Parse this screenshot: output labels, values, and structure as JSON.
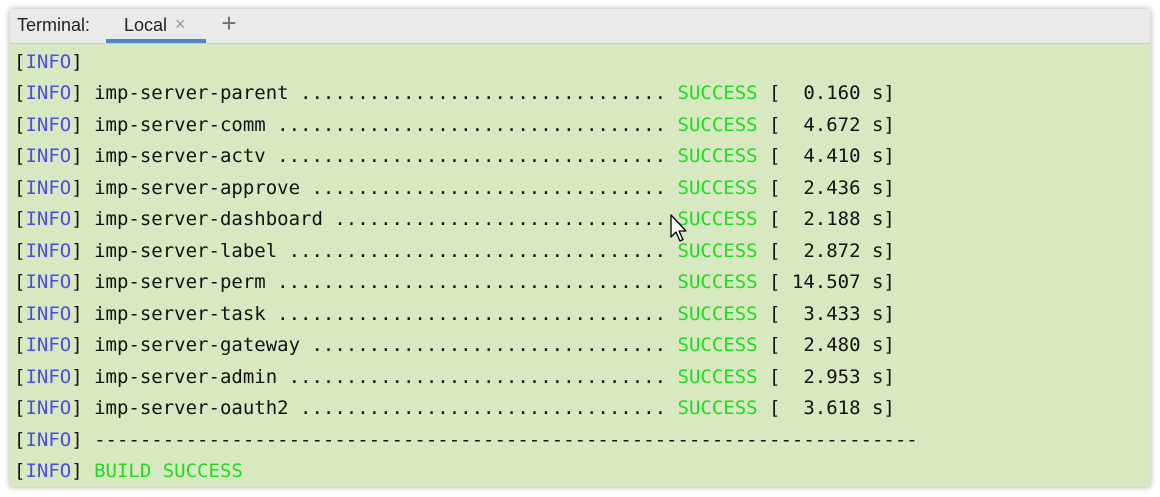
{
  "terminal": {
    "title": "Terminal:",
    "tab_label": "Local",
    "close_glyph": "×",
    "add_glyph": "+"
  },
  "lines": [
    {
      "level": "INFO",
      "text": "",
      "status": "",
      "time": ""
    },
    {
      "level": "INFO",
      "text": "imp-server-parent ................................",
      "status": "SUCCESS",
      "time": "[  0.160 s]"
    },
    {
      "level": "INFO",
      "text": "imp-server-comm ..................................",
      "status": "SUCCESS",
      "time": "[  4.672 s]"
    },
    {
      "level": "INFO",
      "text": "imp-server-actv ..................................",
      "status": "SUCCESS",
      "time": "[  4.410 s]"
    },
    {
      "level": "INFO",
      "text": "imp-server-approve ...............................",
      "status": "SUCCESS",
      "time": "[  2.436 s]"
    },
    {
      "level": "INFO",
      "text": "imp-server-dashboard .............................",
      "status": "SUCCESS",
      "time": "[  2.188 s]"
    },
    {
      "level": "INFO",
      "text": "imp-server-label .................................",
      "status": "SUCCESS",
      "time": "[  2.872 s]"
    },
    {
      "level": "INFO",
      "text": "imp-server-perm ..................................",
      "status": "SUCCESS",
      "time": "[ 14.507 s]"
    },
    {
      "level": "INFO",
      "text": "imp-server-task ..................................",
      "status": "SUCCESS",
      "time": "[  3.433 s]"
    },
    {
      "level": "INFO",
      "text": "imp-server-gateway ...............................",
      "status": "SUCCESS",
      "time": "[  2.480 s]"
    },
    {
      "level": "INFO",
      "text": "imp-server-admin .................................",
      "status": "SUCCESS",
      "time": "[  2.953 s]"
    },
    {
      "level": "INFO",
      "text": "imp-server-oauth2 ................................",
      "status": "SUCCESS",
      "time": "[  3.618 s]"
    },
    {
      "level": "INFO",
      "text": "------------------------------------------------------------------------",
      "status": "",
      "time": ""
    },
    {
      "level": "INFO",
      "text": "",
      "status": "BUILD SUCCESS",
      "time": ""
    }
  ],
  "colors": {
    "background": "#d8e9c2",
    "info": "#4c4ce0",
    "success": "#1fdb1f",
    "tab_underline": "#4a88c7"
  }
}
